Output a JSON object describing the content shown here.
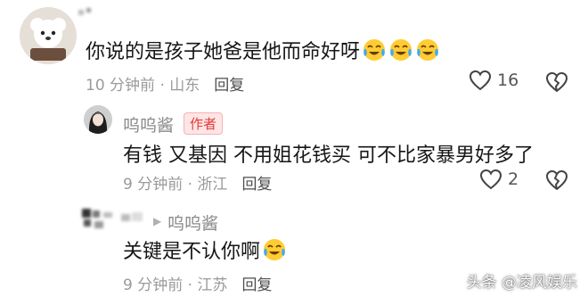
{
  "comment1": {
    "text": "你说的是孩子她爸是他而命好呀",
    "meta_time": "10 分钟前 · 山东",
    "reply": "回复",
    "likes": "16",
    "emoji": "laughing-crying-face"
  },
  "comment2": {
    "username": "呜呜酱",
    "badge": "作者",
    "text": "有钱 又基因 不用姐花钱买 可不比家暴男好多了",
    "meta_time": "9 分钟前 · 浙江",
    "reply": "回复",
    "likes": "2"
  },
  "comment3": {
    "replied_to": "呜呜酱",
    "text": "关键是不认你啊",
    "meta_time": "9 分钟前 · 江苏",
    "reply": "回复",
    "emoji": "laughing-crying-face"
  },
  "watermark": "头条 @凌风娱乐",
  "colors": {
    "author_badge": "#e23a3a",
    "meta": "#9a9a9a",
    "text": "#161616"
  }
}
